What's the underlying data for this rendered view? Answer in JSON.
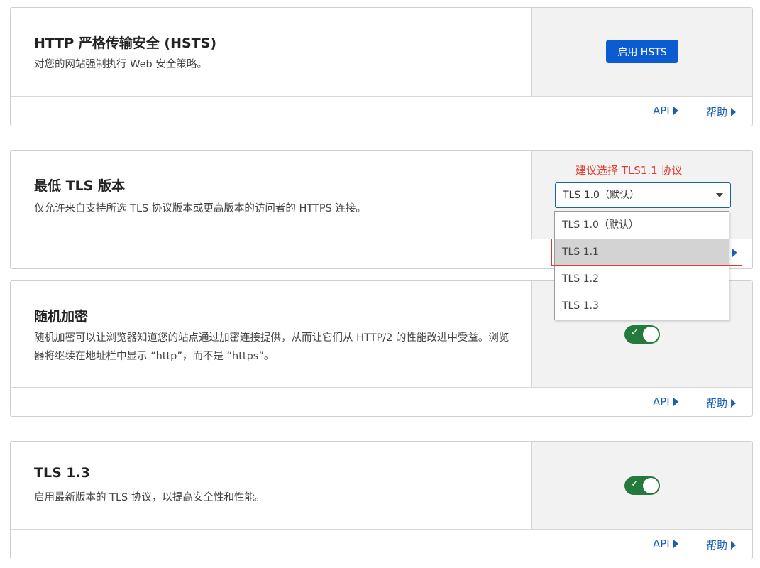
{
  "hsts": {
    "title": "HTTP 严格传输安全 (HSTS)",
    "description": "对您的网站强制执行 Web 安全策略。",
    "button_label": "启用 HSTS",
    "api_label": "API",
    "help_label": "帮助"
  },
  "min_tls": {
    "title": "最低 TLS 版本",
    "description": "仅允许来自支持所选 TLS 协议版本或更高版本的访问者的 HTTPS 连接。",
    "hint": "建议选择 TLS1.1 协议",
    "selected": "TLS 1.0（默认）",
    "options": [
      "TLS 1.0（默认）",
      "TLS 1.1",
      "TLS 1.2",
      "TLS 1.3"
    ],
    "highlighted_option": "TLS 1.1"
  },
  "random_encryption": {
    "title": "随机加密",
    "description": "随机加密可以让浏览器知道您的站点通过加密连接提供，从而让它们从 HTTP/2 的性能改进中受益。浏览器将继续在地址栏中显示 “http”，而不是 “https”。",
    "enabled": true,
    "api_label": "API",
    "help_label": "帮助"
  },
  "tls13": {
    "title": "TLS 1.3",
    "description": "启用最新版本的 TLS 协议，以提高安全性和性能。",
    "enabled": true,
    "api_label": "API",
    "help_label": "帮助"
  },
  "colors": {
    "accent": "#0b5bd3",
    "link": "#1a5fb4",
    "toggle_on": "#237a3c",
    "highlight_red": "#e03a2e"
  }
}
